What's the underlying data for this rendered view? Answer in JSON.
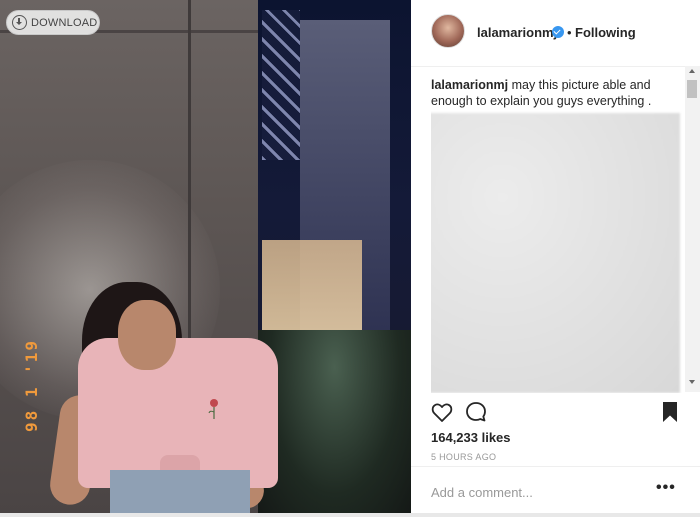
{
  "photo": {
    "date_stamp": "98 1 '19",
    "download_label": "DOWNLOAD"
  },
  "post": {
    "username": "lalamarionmj",
    "verified": true,
    "separator": "•",
    "follow_status": "Following",
    "caption_user": "lalamarionmj",
    "caption_text": " may this picture able and enough to explain you guys everything .",
    "likes": "164,233 likes",
    "time_ago": "5 HOURS AGO",
    "comment_placeholder": "Add a comment...",
    "more_label": "•••"
  },
  "icons": {
    "like": "heart-icon",
    "comment": "comment-icon",
    "save": "bookmark-icon",
    "download": "download-icon",
    "verified": "verified-badge-icon"
  },
  "colors": {
    "verified": "#3897f0",
    "text": "#262626",
    "muted": "#999999",
    "stamp": "#f09a3c"
  }
}
